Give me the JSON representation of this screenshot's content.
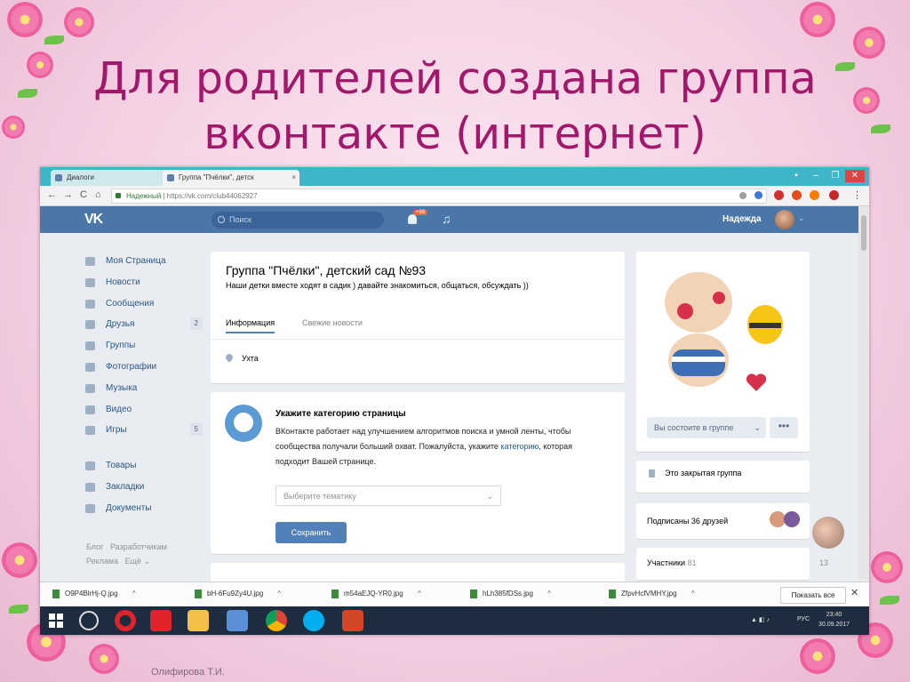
{
  "slide": {
    "title_line1": "Для родителей создана группа",
    "title_line2": "вконтакте (интернет)",
    "author": "Олифирова Т.И."
  },
  "browser": {
    "tabs": [
      {
        "label": "Диалоги",
        "close": "×"
      },
      {
        "label": "Группа \"Пчёлки\", детск",
        "close": "×"
      }
    ],
    "window_controls": [
      "–",
      "❐",
      "✕"
    ],
    "nav": {
      "back": "←",
      "forward": "→",
      "reload": "C",
      "home": "⌂"
    },
    "url_secure": "Надежный",
    "url_sep": " | ",
    "url": "https://vk.com/club44062927"
  },
  "vk": {
    "logo": "VK",
    "search_placeholder": "Поиск",
    "notifications_badge": "+99",
    "user_name": "Надежда",
    "menu": [
      {
        "label": "Моя Страница",
        "icon": "home-icon"
      },
      {
        "label": "Новости",
        "icon": "news-icon"
      },
      {
        "label": "Сообщения",
        "icon": "messages-icon"
      },
      {
        "label": "Друзья",
        "icon": "friends-icon",
        "count": "2"
      },
      {
        "label": "Группы",
        "icon": "groups-icon"
      },
      {
        "label": "Фотографии",
        "icon": "camera-icon"
      },
      {
        "label": "Музыка",
        "icon": "music-icon"
      },
      {
        "label": "Видео",
        "icon": "video-icon"
      },
      {
        "label": "Игры",
        "icon": "games-icon",
        "count": "5"
      },
      {
        "label": "Товары",
        "icon": "bag-icon"
      },
      {
        "label": "Закладки",
        "icon": "star-icon"
      },
      {
        "label": "Документы",
        "icon": "document-icon"
      }
    ],
    "footer": {
      "blog": "Блог",
      "developers": "Разработчикам",
      "ads": "Реклама",
      "more": "Ещё ⌄"
    },
    "group": {
      "title": "Группа \"Пчёлки\", детский сад №93",
      "status": "Наши детки вместе ходят в садик ) давайте знакомиться, общаться, обсуждать ))",
      "tabs": [
        "Информация",
        "Свежие новости"
      ],
      "city": "Ухта"
    },
    "category": {
      "title": "Укажите категорию страницы",
      "text_before": "ВКонтакте работает над улучшением алгоритмов поиска и умной ленты, чтобы сообщества получали больший охват. Пожалуйста, укажите ",
      "text_link": "категорию",
      "text_after": ", которая подходит Вашей странице.",
      "select_placeholder": "Выберите тематику",
      "save_label": "Сохранить"
    },
    "right": {
      "member_button": "Вы состоите в группе",
      "more_button": "•••",
      "closed_group": "Это закрытая группа",
      "friends_text": "Подписаны 36 друзей",
      "members_label": "Участники",
      "members_count": "81",
      "side_number": "13"
    }
  },
  "downloads": {
    "files": [
      "O9P4BlrHj-Q.jpg",
      "bH-6Fu9Zy4U.jpg",
      "m54aEJQ-YR0.jpg",
      "hLh385fDSs.jpg",
      "ZfpvHcfVMHY.jpg"
    ],
    "show_all": "Показать все",
    "close": "✕"
  },
  "taskbar": {
    "lang": "РУС",
    "time": "23:40",
    "date": "30.09.2017"
  },
  "colors": {
    "title": "#a2186a",
    "vk_header": "#4a76a8",
    "vk_button": "#5181b8",
    "tabbar": "#3fb6c7"
  }
}
